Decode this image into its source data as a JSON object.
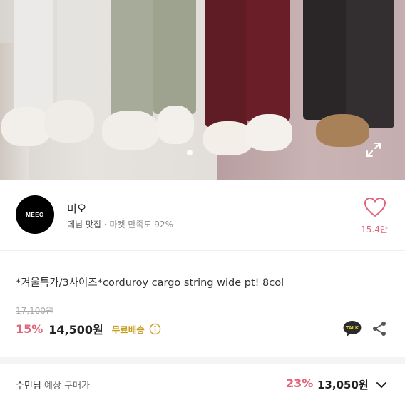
{
  "product_image": {
    "description_icon": "expand-icon",
    "carousel_dots": 2
  },
  "seller": {
    "logo_text": "MEEO",
    "name": "미오",
    "category": "데님 맛집",
    "separator": "·",
    "satisfaction": "마켓 만족도 92%",
    "like_count": "15.4만"
  },
  "product": {
    "title": "*겨울특가/3사이즈*corduroy cargo string wide pt! 8col",
    "original_price": "17,100원",
    "discount": "15%",
    "price": "14,500원",
    "shipping": "무료배송"
  },
  "actions": {
    "talk_icon_text": "TALK"
  },
  "member_price": {
    "user": "수민님",
    "label": "예상 구매가",
    "discount": "23%",
    "price": "13,050원"
  },
  "colors": {
    "accent_pink": "#e0647a",
    "shipping_gold": "#c79d1e"
  }
}
